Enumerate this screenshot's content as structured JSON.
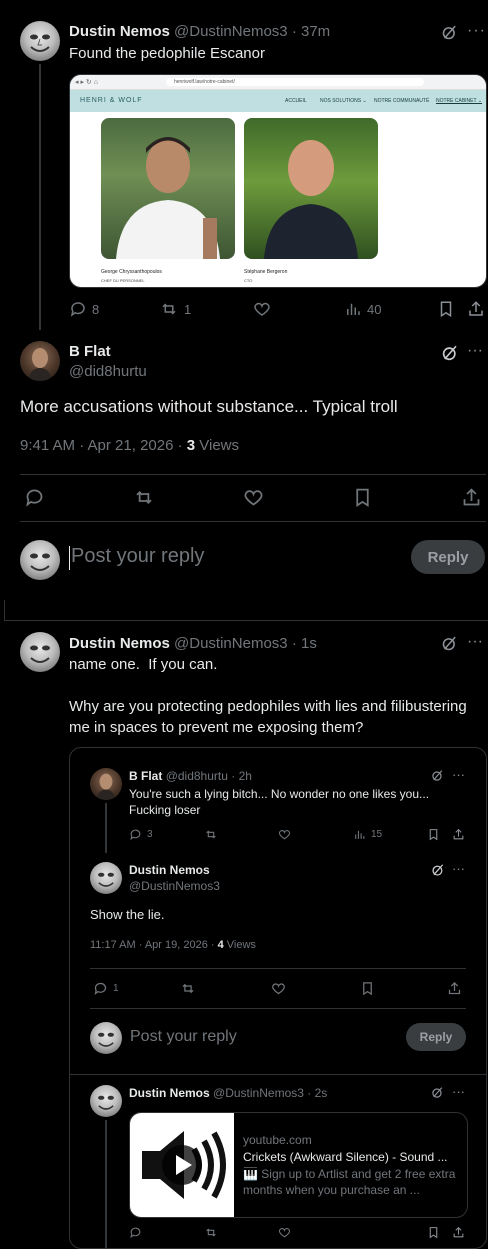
{
  "post1": {
    "author": "Dustin Nemos",
    "handle": "@DustinNemos3",
    "time": "· 37m",
    "text": "Found the pedophile Escanor",
    "image": {
      "url": "henriwolf.law/notre-cabinet/",
      "brand": "HENRI & WOLF",
      "nav": [
        "ACCUEIL",
        "NOS SOLUTIONS ⌄",
        "NOTRE COMMUNAUTÉ",
        "NOTRE CABINET ⌄"
      ],
      "persons": [
        {
          "name": "George Chryssanthopoulos",
          "role": "CHEF DU PERSONNEL"
        },
        {
          "name": "Stéphane Bergeron",
          "role": "CTO"
        }
      ]
    },
    "actions": {
      "replies": "8",
      "reposts": "1",
      "likes": "",
      "views": "40"
    }
  },
  "post2": {
    "author": "B Flat",
    "handle": "@did8hurtu",
    "text": "More accusations without substance... Typical troll",
    "meta_time": "9:41 AM · Apr 21, 2026 · ",
    "meta_views_count": "3",
    "meta_views_label": " Views"
  },
  "reply_box": {
    "placeholder": "Post your reply",
    "button": "Reply"
  },
  "post3": {
    "author": "Dustin Nemos",
    "handle": "@DustinNemos3",
    "time": "· 1s",
    "line1": "name one.  If you can.",
    "line2": "Why are you protecting pedophiles with lies and filibustering me in spaces to prevent me exposing them?"
  },
  "quote": {
    "q1": {
      "author": "B Flat",
      "handle": "@did8hurtu",
      "time": "· 2h",
      "text": "You're such a lying bitch... No wonder no one likes you... Fucking loser",
      "replies": "3",
      "views": "15"
    },
    "q2": {
      "author": "Dustin Nemos",
      "handle": "@DustinNemos3",
      "text": "Show the lie.",
      "meta_time": "11:17 AM · Apr 19, 2026 · ",
      "meta_views_count": "4",
      "meta_views_label": " Views",
      "replies": "1"
    },
    "reply_placeholder": "Post your reply",
    "reply_button": "Reply",
    "q3": {
      "author": "Dustin Nemos",
      "handle": "@DustinNemos3",
      "time": "· 2s",
      "card_domain": "youtube.com",
      "card_title": "Crickets (Awkward Silence) - Sound ...",
      "card_desc": "🎹 Sign up to Artlist and get 2 free extra months when you purchase an ..."
    }
  }
}
